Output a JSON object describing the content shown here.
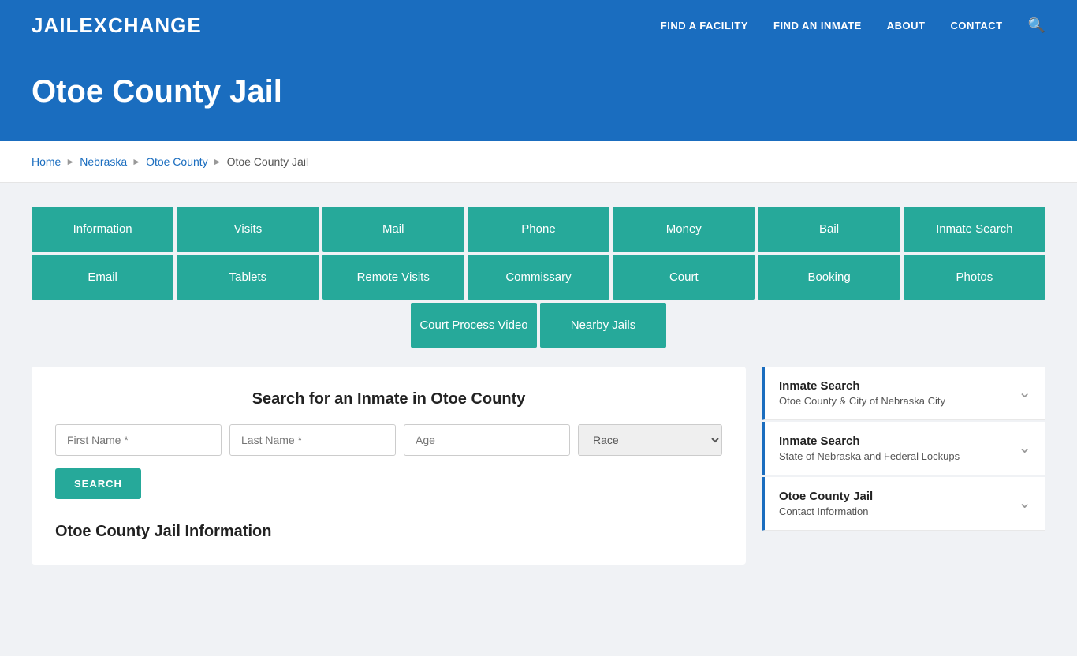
{
  "header": {
    "logo_jail": "JAIL",
    "logo_exchange": "EXCHANGE",
    "nav": [
      {
        "label": "FIND A FACILITY",
        "id": "find-facility"
      },
      {
        "label": "FIND AN INMATE",
        "id": "find-inmate"
      },
      {
        "label": "ABOUT",
        "id": "about"
      },
      {
        "label": "CONTACT",
        "id": "contact"
      }
    ]
  },
  "hero": {
    "title": "Otoe County Jail"
  },
  "breadcrumb": {
    "items": [
      "Home",
      "Nebraska",
      "Otoe County",
      "Otoe County Jail"
    ]
  },
  "nav_buttons_row1": [
    "Information",
    "Visits",
    "Mail",
    "Phone",
    "Money",
    "Bail",
    "Inmate Search"
  ],
  "nav_buttons_row2": [
    "Email",
    "Tablets",
    "Remote Visits",
    "Commissary",
    "Court",
    "Booking",
    "Photos"
  ],
  "nav_buttons_row3": [
    "Court Process Video",
    "Nearby Jails"
  ],
  "search": {
    "title": "Search for an Inmate in Otoe County",
    "first_name_placeholder": "First Name *",
    "last_name_placeholder": "Last Name *",
    "age_placeholder": "Age",
    "race_placeholder": "Race",
    "button_label": "SEARCH"
  },
  "info": {
    "heading": "Otoe County Jail Information"
  },
  "sidebar": {
    "items": [
      {
        "title": "Inmate Search",
        "subtitle": "Otoe County & City of Nebraska City"
      },
      {
        "title": "Inmate Search",
        "subtitle": "State of Nebraska and Federal Lockups"
      },
      {
        "title": "Otoe County Jail",
        "subtitle": "Contact Information"
      }
    ]
  }
}
